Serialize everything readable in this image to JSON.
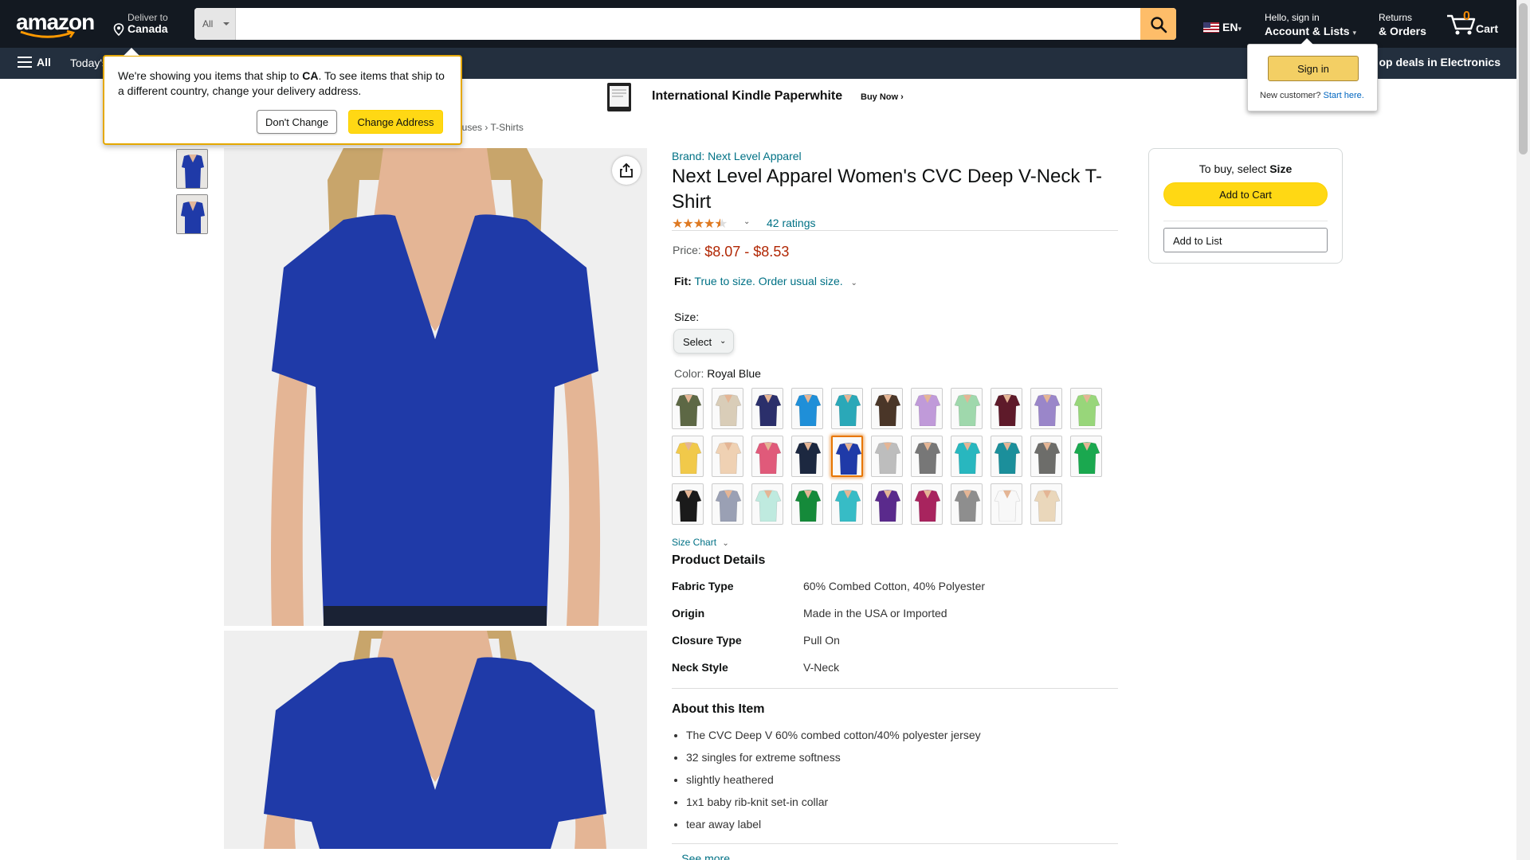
{
  "header": {
    "deliver_to_label": "Deliver to",
    "deliver_to_country": "Canada",
    "search_category": "All",
    "search_placeholder": "",
    "language": "EN",
    "account_greeting": "Hello, sign in",
    "account_label": "Account & Lists",
    "returns_label": "Returns",
    "orders_label": "& Orders",
    "cart_count": "0",
    "cart_label": "Cart"
  },
  "nav": {
    "all_label": "All",
    "today_label": "Today's",
    "deals_label": "op deals in Electronics"
  },
  "promo": {
    "title": "International Kindle Paperwhite",
    "cta": "Buy Now ›"
  },
  "breadcrumb": {
    "parts": [
      "ouses",
      "T-Shirts"
    ],
    "separator": "›"
  },
  "address_popover": {
    "msg_before": "We're showing you items that ship to ",
    "country_code": "CA",
    "msg_after": ". To see items that ship to a different country, change your delivery address.",
    "dont_change": "Don't Change",
    "change_address": "Change Address"
  },
  "signin_popover": {
    "button": "Sign in",
    "new_customer": "New customer?",
    "start_here": "Start here."
  },
  "product": {
    "brand": "Brand: Next Level Apparel",
    "title": "Next Level Apparel Women's CVC Deep V-Neck T-Shirt",
    "rating_stars": 4.5,
    "rating_count": "42 ratings",
    "price_label": "Price:",
    "price_range": "$8.07 - $8.53",
    "fit_label": "Fit:",
    "fit_value": "True to size. Order usual size.",
    "size_label": "Size:",
    "size_select": "Select",
    "color_label": "Color:",
    "color_selected": "Royal Blue",
    "size_chart": "Size Chart",
    "colors": [
      {
        "name": "color-1",
        "hex": "#5d6845"
      },
      {
        "name": "color-2",
        "hex": "#d9cdb8"
      },
      {
        "name": "color-3",
        "hex": "#2b2f6b"
      },
      {
        "name": "color-4",
        "hex": "#1f8fd8"
      },
      {
        "name": "color-5",
        "hex": "#2aa8b8"
      },
      {
        "name": "color-6",
        "hex": "#4a3628"
      },
      {
        "name": "color-7",
        "hex": "#c09ad9"
      },
      {
        "name": "color-8",
        "hex": "#9fd8ac"
      },
      {
        "name": "color-9",
        "hex": "#5e1a2a"
      },
      {
        "name": "color-10",
        "hex": "#9a86c9"
      },
      {
        "name": "color-11",
        "hex": "#98d67a"
      },
      {
        "name": "color-12",
        "hex": "#f1c94a"
      },
      {
        "name": "color-13",
        "hex": "#efd1b3"
      },
      {
        "name": "color-14",
        "hex": "#e05a7a"
      },
      {
        "name": "color-15",
        "hex": "#1c2840"
      },
      {
        "name": "color-16",
        "hex": "#1f3aa8"
      },
      {
        "name": "color-17",
        "hex": "#bdbdbd"
      },
      {
        "name": "color-18",
        "hex": "#777777"
      },
      {
        "name": "color-19",
        "hex": "#28b7bf"
      },
      {
        "name": "color-20",
        "hex": "#1b8f9b"
      },
      {
        "name": "color-21",
        "hex": "#6d6d6a"
      },
      {
        "name": "color-22",
        "hex": "#1aa84f"
      },
      {
        "name": "color-23",
        "hex": "#1a1a1a"
      },
      {
        "name": "color-24",
        "hex": "#9aa0b4"
      },
      {
        "name": "color-25",
        "hex": "#bfeadf"
      },
      {
        "name": "color-26",
        "hex": "#158a3a"
      },
      {
        "name": "color-27",
        "hex": "#37bcc6"
      },
      {
        "name": "color-28",
        "hex": "#5a2a8c"
      },
      {
        "name": "color-29",
        "hex": "#a8245e"
      },
      {
        "name": "color-30",
        "hex": "#8e8e8e"
      },
      {
        "name": "color-31",
        "hex": "#f8f8f8"
      },
      {
        "name": "color-32",
        "hex": "#ead7bb"
      }
    ],
    "selected_color_index": 15,
    "details_title": "Product Details",
    "details": [
      {
        "key": "Fabric Type",
        "value": "60% Combed Cotton, 40% Polyester"
      },
      {
        "key": "Origin",
        "value": "Made in the USA or Imported"
      },
      {
        "key": "Closure Type",
        "value": "Pull On"
      },
      {
        "key": "Neck Style",
        "value": "V-Neck"
      }
    ],
    "about_title": "About this Item",
    "about": [
      "The CVC Deep V 60% combed cotton/40% polyester jersey",
      "32 singles for extreme softness",
      "slightly heathered",
      "1x1 baby rib-knit set-in collar",
      "tear away label"
    ],
    "see_more": "See more"
  },
  "buybox": {
    "hint_prefix": "To buy, select ",
    "hint_strong": "Size",
    "add_to_cart": "Add to Cart",
    "add_to_list": "Add to List"
  },
  "colors": {
    "nav_dark": "#131921",
    "nav_secondary": "#232f3e",
    "accent": "#febd69",
    "price": "#b12704",
    "link": "#007185",
    "shirt": "#1f3aa8"
  }
}
